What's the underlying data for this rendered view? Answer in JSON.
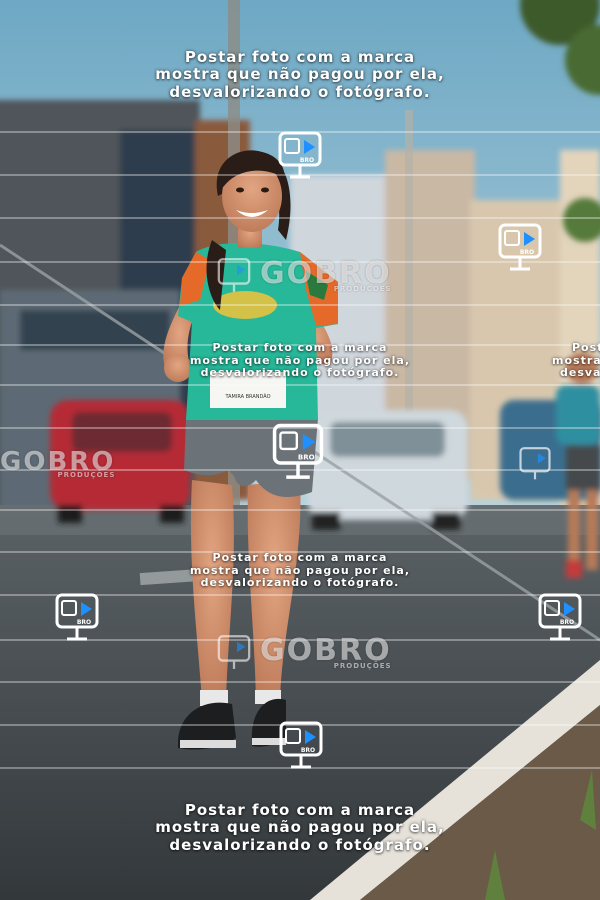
{
  "watermark": {
    "line1": "Postar foto com a marca",
    "line2": "mostra que não pagou por ela,",
    "line3": "desvalorizando o fotógrafo.",
    "side_line1": "Post",
    "side_line2": "mostra",
    "side_line3": "desva",
    "brand": "GOBRO",
    "brand_sub": "PRODUÇÕES",
    "camera_badge": "BRO"
  },
  "bib": {
    "name": "TAMIRA BRANDÃO"
  },
  "colors": {
    "sky": "#7fb3c8",
    "shirt": "#27b89a",
    "road": "#3f4448",
    "car": "#c0323c"
  }
}
